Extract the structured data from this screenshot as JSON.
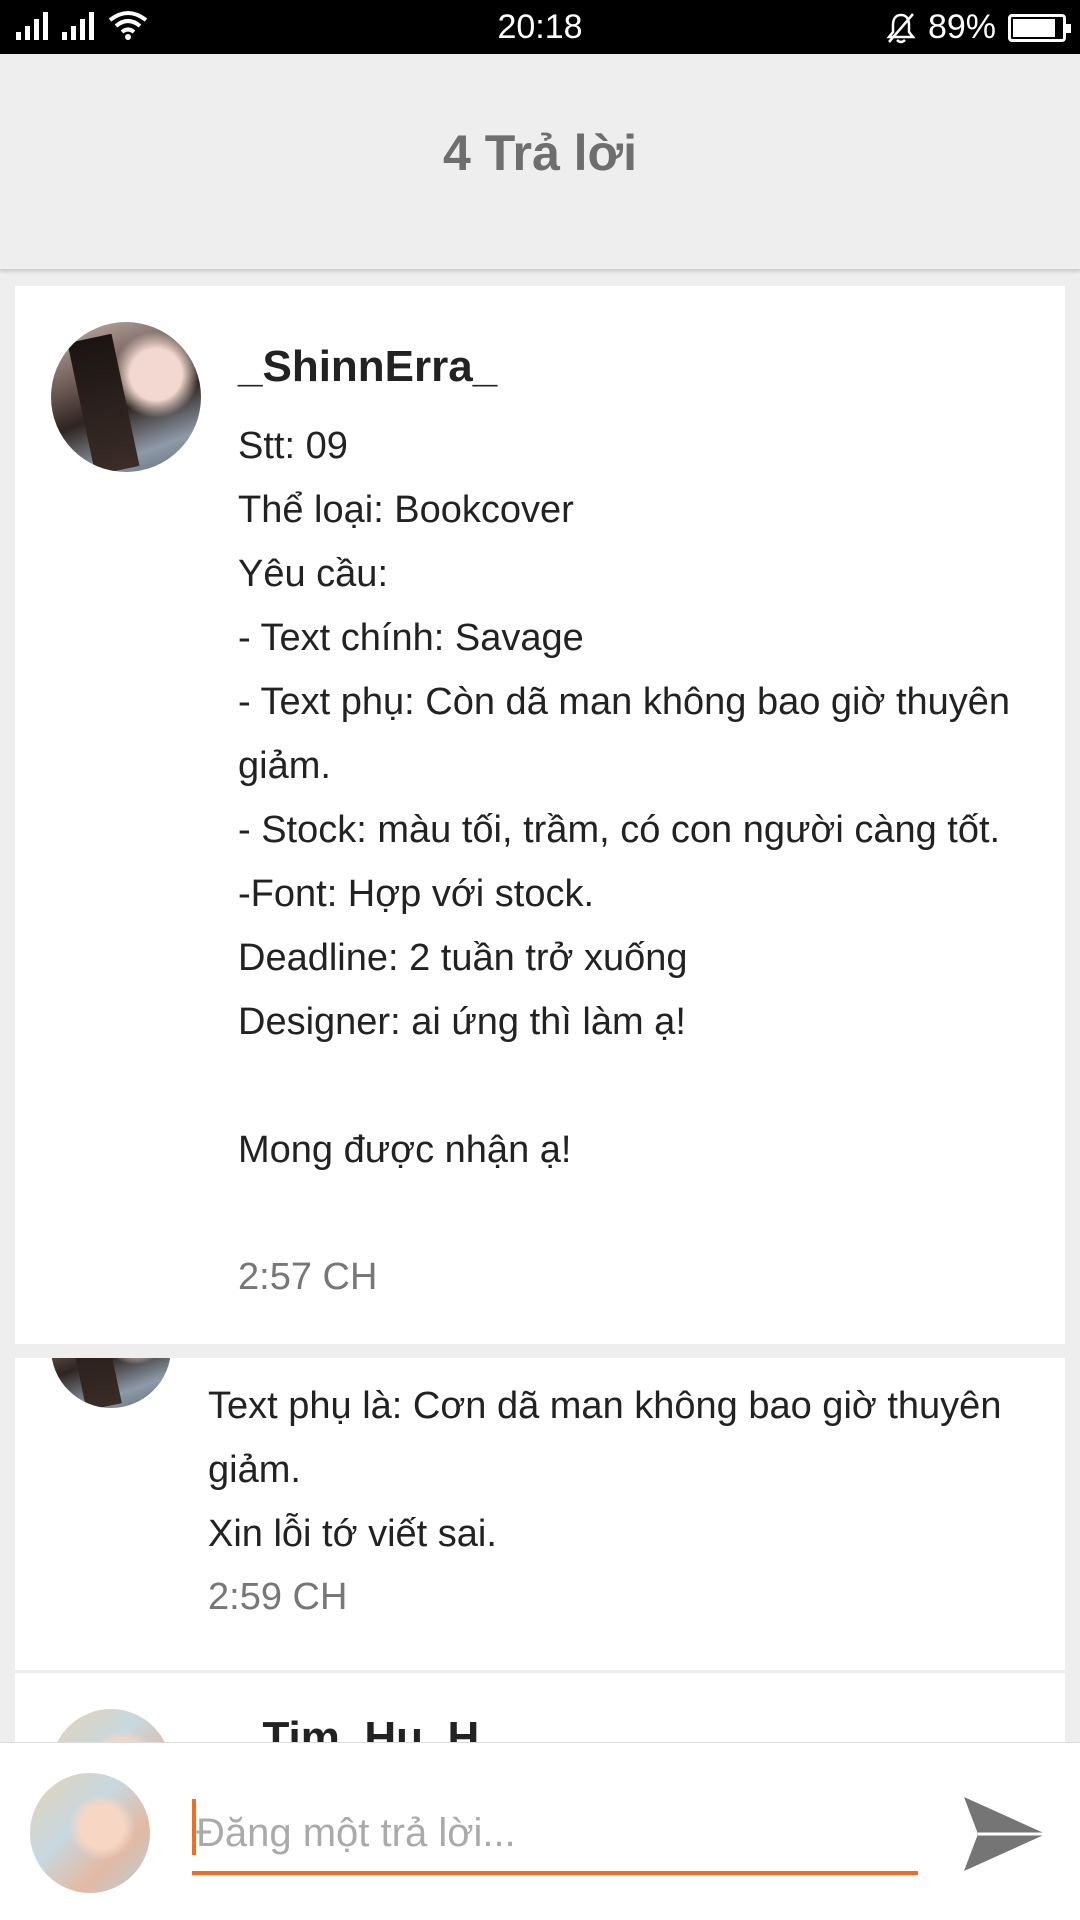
{
  "status_bar": {
    "time": "20:18",
    "battery_text": "89%",
    "battery_level": 0.89
  },
  "header": {
    "title": "4 Trả lời"
  },
  "replies": [
    {
      "username": "_ShinnErra_",
      "body": "Stt: 09\nThể loại: Bookcover\nYêu cầu:\n- Text chính: Savage\n- Text phụ: Còn dã man không bao giờ thuyên giảm.\n- Stock: màu tối, trầm, có con người càng tốt.\n-Font: Hợp với stock.\nDeadline: 2 tuần trở xuống\nDesigner: ai ứng thì làm ạ!\n\nMong được nhận ạ!",
      "time": "2:57 CH"
    },
    {
      "body": "Text phụ là: Cơn dã man không bao giờ thuyên giảm.\nXin lỗi tớ viết sai.",
      "time": "2:59 CH"
    },
    {
      "username_partial": "_Tim_Hu_H"
    }
  ],
  "composer": {
    "placeholder": "Đăng một trả lời...",
    "value": "",
    "accent_color": "#ef6c2b",
    "send_icon": "send-icon"
  }
}
